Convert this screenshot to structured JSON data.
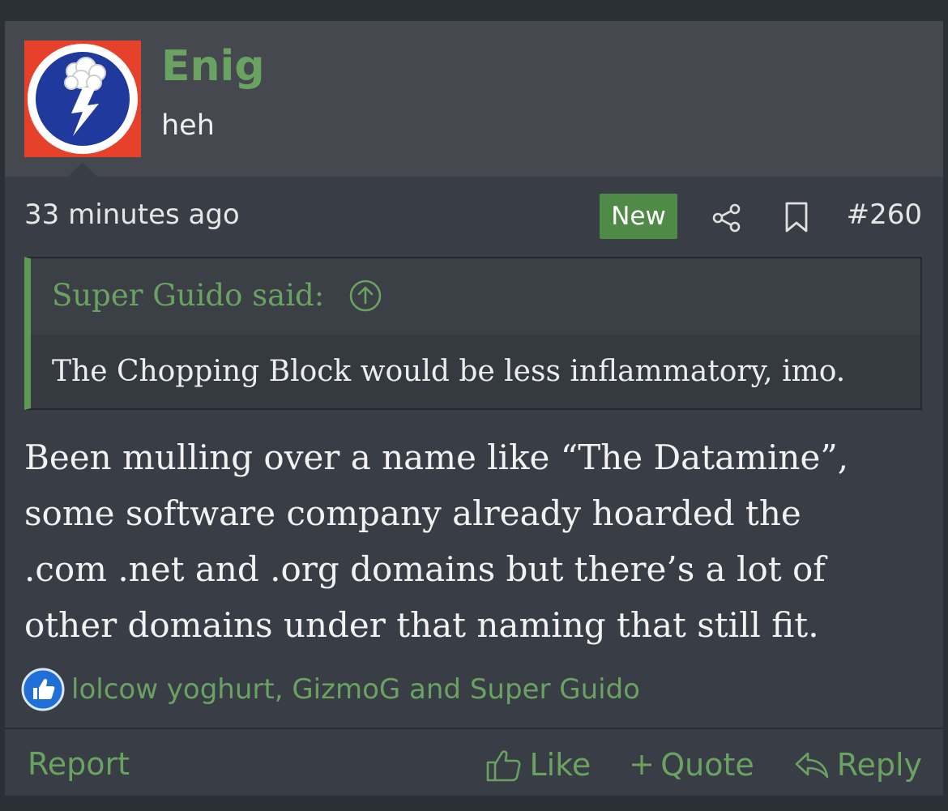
{
  "user": {
    "name": "Enig",
    "title": "heh"
  },
  "meta": {
    "time": "33 minutes ago",
    "badge": "New",
    "post_number": "#260"
  },
  "quote": {
    "author_line": "Super Guido said:",
    "text": "The Chopping Block would be less inflammatory, imo."
  },
  "body": {
    "lines": [
      "Been mulling over a name like “The Datamine”,",
      "some software company already hoarded the",
      ".com .net and .org domains but there’s a lot of",
      "other domains under that naming that still fit."
    ]
  },
  "reactions": {
    "text": "lolcow yoghurt, GizmoG and Super Guido"
  },
  "footer": {
    "report": "Report",
    "like": "Like",
    "quote": "Quote",
    "reply": "Reply"
  },
  "colors": {
    "accent_green": "#6aa361",
    "badge_green": "#4f8a47",
    "avatar_bg": "#e6412a",
    "avatar_blue": "#1f3a9c"
  },
  "icons": [
    "share-icon",
    "bookmark-icon",
    "arrow-up-circle-icon",
    "like-reaction-icon",
    "thumbs-up-icon",
    "plus-icon",
    "reply-icon"
  ]
}
